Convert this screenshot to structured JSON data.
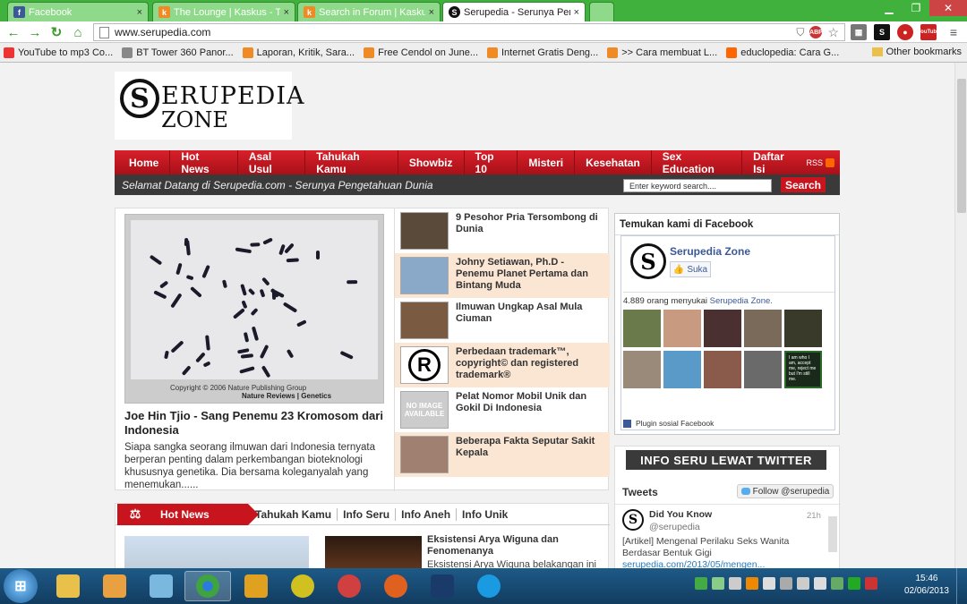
{
  "tabs": [
    {
      "title": "Facebook",
      "icon": "facebook-icon",
      "color": "#3b5998"
    },
    {
      "title": "The Lounge | Kaskus - Th",
      "icon": "kaskus-icon",
      "color": "#f08a24"
    },
    {
      "title": "Search in Forum | Kaskus",
      "icon": "kaskus-icon",
      "color": "#f08a24"
    },
    {
      "title": "Serupedia - Serunya Peng",
      "icon": "serupedia-icon",
      "color": "#111111"
    }
  ],
  "address": {
    "url": "www.serupedia.com"
  },
  "extensions": [
    "ABP",
    "S",
    "YouTube"
  ],
  "bookmarks": [
    {
      "label": "YouTube to mp3 Co...",
      "color": "#e33"
    },
    {
      "label": "BT Tower 360 Panor...",
      "color": "#888"
    },
    {
      "label": "Laporan, Kritik, Sara...",
      "color": "#f08a24"
    },
    {
      "label": "Free Cendol on June...",
      "color": "#f08a24"
    },
    {
      "label": "Internet Gratis Deng...",
      "color": "#f08a24"
    },
    {
      "label": ">> Cara membuat L...",
      "color": "#f08a24"
    },
    {
      "label": "educlopedia: Cara G...",
      "color": "#f60"
    }
  ],
  "other_bookmarks": "Other bookmarks",
  "site": {
    "logo_line1": "ERUPEDIA",
    "logo_line2": "ZONE",
    "logo_mark": "S",
    "menu": [
      "Home",
      "Hot News",
      "Asal Usul",
      "Tahukah Kamu",
      "Showbiz",
      "Top 10",
      "Misteri",
      "Kesehatan",
      "Sex Education",
      "Daftar Isi"
    ],
    "rss": "RSS",
    "welcome": "Selamat Datang di Serupedia.com - Serunya Pengetahuan Dunia",
    "search_placeholder": "Enter keyword search....",
    "search_button": "Search"
  },
  "featured": {
    "image_copyright": "Copyright © 2006 Nature Publishing Group",
    "image_source": "Nature Reviews | Genetics",
    "title": "Joe Hin Tjio - Sang Penemu 23 Kromosom dari Indonesia",
    "excerpt": "Siapa sangka seorang ilmuwan dari Indonesia ternyata berperan penting dalam perkembangan bioteknologi khususnya genetika. Dia bersama koleganyalah yang menemukan......"
  },
  "side_articles": [
    {
      "title": "9 Pesohor Pria Tersombong di Dunia",
      "thumb": "#5a4a3a"
    },
    {
      "title": "Johny Setiawan, Ph.D - Penemu Planet Pertama dan Bintang Muda",
      "thumb": "#8aa8c8"
    },
    {
      "title": "Ilmuwan Ungkap Asal Mula Ciuman",
      "thumb": "#7a5a40"
    },
    {
      "title": "Perbedaan trademark™, copyright© dan registered trademark®",
      "thumb": "#ffffff"
    },
    {
      "title": "Pelat Nomor Mobil Unik dan Gokil Di Indonesia",
      "thumb": "#cccccc"
    },
    {
      "title": "Beberapa Fakta Seputar Sakit Kepala",
      "thumb": "#a08070"
    }
  ],
  "no_image_text": "NO IMAGE AVAILABLE",
  "facebook": {
    "header": "Temukan kami di Facebook",
    "page_name": "Serupedia Zone",
    "like_label": "Suka",
    "count_text": "4.889 orang menyukai",
    "count_link": "Serupedia Zone.",
    "plugin_label": "Plugin sosial Facebook",
    "faces": [
      "#6a7a4a",
      "#c89a80",
      "#4a3030",
      "#7a6a5a",
      "#3a3a2a",
      "#9a8a7a",
      "#5a9ac8",
      "#8a5a4a",
      "#6a6a6a",
      "#1a2a1a"
    ],
    "last_face_text": "I am who I am, accept me, reject me but I'm still me."
  },
  "twitter": {
    "banner": "INFO SERU LEWAT TWITTER",
    "tweets_label": "Tweets",
    "follow_label": "Follow @serupedia",
    "author": "Did You Know",
    "handle": "@serupedia",
    "time": "21h",
    "text": "[Artikel] Mengenal Perilaku Seks Wanita Berdasar Bentuk Gigi",
    "link": "serupedia.com/2013/05/mengen..."
  },
  "hot_news": {
    "label": "Hot News",
    "tabs": [
      "Tahukah Kamu",
      "Info Seru",
      "Info Aneh",
      "Info Unik"
    ],
    "article_title": "Eksistensi Arya Wiguna dan Fenomenanya",
    "article_excerpt": "Eksistensi Arya Wiguna belakangan ini"
  },
  "taskbar": {
    "apps": [
      {
        "name": "explorer",
        "color": "#e8c04a"
      },
      {
        "name": "media",
        "color": "#e8a040"
      },
      {
        "name": "notepad",
        "color": "#7ab8e0"
      },
      {
        "name": "chrome",
        "color": "#3fa33f"
      },
      {
        "name": "tasks",
        "color": "#e0a020"
      },
      {
        "name": "winamp",
        "color": "#d0c020"
      },
      {
        "name": "search",
        "color": "#d04040"
      },
      {
        "name": "firefox",
        "color": "#e06020"
      },
      {
        "name": "photoshop",
        "color": "#1a3a6a"
      },
      {
        "name": "skype",
        "color": "#1a9ae0"
      }
    ],
    "time": "15:46",
    "date": "02/06/2013"
  }
}
